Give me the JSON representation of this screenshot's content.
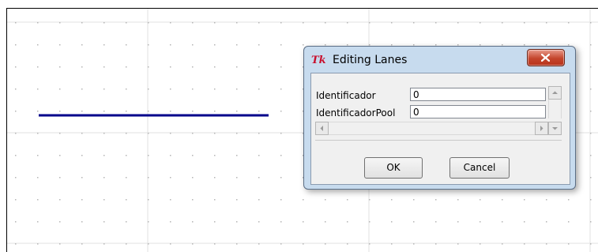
{
  "dialog": {
    "title": "Editing Lanes",
    "tk_logo": "Tk",
    "close_icon": "close-x-icon",
    "fields": [
      {
        "label": "Identificador",
        "value": "0"
      },
      {
        "label": "IdentificadorPool",
        "value": "0"
      }
    ],
    "ok_label": "OK",
    "cancel_label": "Cancel"
  },
  "canvas": {
    "lane_color": "#00008b",
    "grid_line_color": "#e2e2e2",
    "grid_dot_color": "#b5b5b5"
  }
}
